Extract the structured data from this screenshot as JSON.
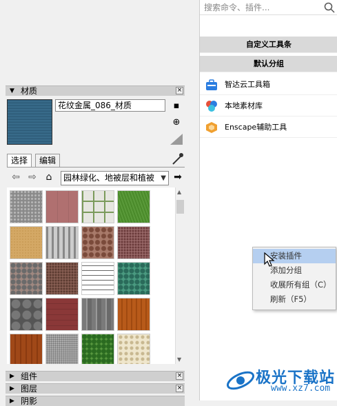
{
  "materials": {
    "title": "材质",
    "material_name": "花纹金属_086_材质",
    "tabs": [
      "选择",
      "编辑"
    ],
    "category": "园林绿化、地被层和植被",
    "thumbnails": [
      {
        "name": "gravel-gray"
      },
      {
        "name": "pavers-red"
      },
      {
        "name": "pavers-grass-joint"
      },
      {
        "name": "grass"
      },
      {
        "name": "sand"
      },
      {
        "name": "fence-gate"
      },
      {
        "name": "mulch-brown"
      },
      {
        "name": "gravel-red"
      },
      {
        "name": "stone-mixed"
      },
      {
        "name": "gravel-brown"
      },
      {
        "name": "barbed-wire"
      },
      {
        "name": "ivy-green"
      },
      {
        "name": "cobble-gray"
      },
      {
        "name": "brick-red"
      },
      {
        "name": "wood-gray"
      },
      {
        "name": "fence-lattice"
      },
      {
        "name": "wood-red"
      },
      {
        "name": "gravel-fine"
      },
      {
        "name": "shrub-green"
      },
      {
        "name": "ground-cream"
      }
    ]
  },
  "collapsed_panels": [
    "组件",
    "图层",
    "阴影"
  ],
  "plugins": {
    "search_placeholder": "搜索命令、插件...",
    "group_custom_toolbar": "自定义工具条",
    "group_default": "默认分组",
    "items": [
      {
        "label": "智达云工具箱",
        "icon": "toolbox-icon",
        "color": "#2b7de0"
      },
      {
        "label": "本地素材库",
        "icon": "asset-library-icon",
        "color": "#e6503a"
      },
      {
        "label": "Enscape辅助工具",
        "icon": "enscape-icon",
        "color": "#f0a030"
      }
    ]
  },
  "context_menu": {
    "items": [
      "安装插件",
      "添加分组",
      "收展所有组（C）",
      "刷新（F5）"
    ],
    "highlighted": 0
  },
  "watermark": {
    "main": "极光下载站",
    "sub": "www.xz7.com"
  }
}
